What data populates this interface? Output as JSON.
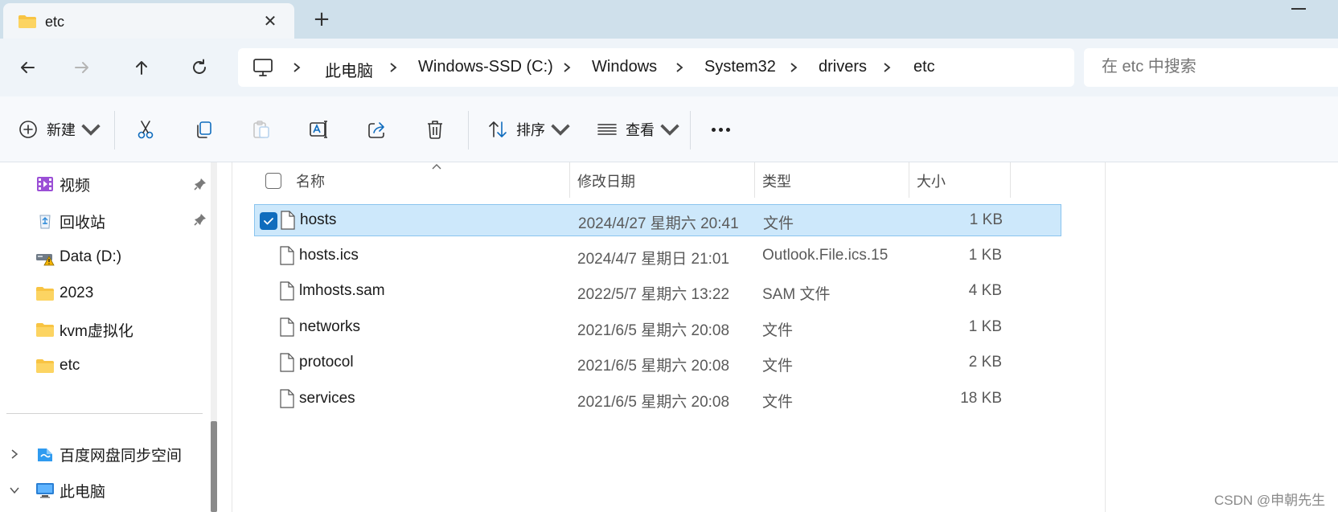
{
  "tab": {
    "title": "etc",
    "close_icon": "close-icon",
    "new_tab_icon": "plus-icon"
  },
  "nav": {
    "back": "back-arrow-icon",
    "forward": "forward-arrow-icon",
    "up": "up-arrow-icon",
    "refresh": "refresh-icon"
  },
  "breadcrumb": [
    "此电脑",
    "Windows-SSD (C:)",
    "Windows",
    "System32",
    "drivers",
    "etc"
  ],
  "search": {
    "placeholder": "在 etc 中搜索"
  },
  "toolbar": {
    "new_label": "新建",
    "sort_label": "排序",
    "view_label": "查看"
  },
  "sidebar": {
    "items": [
      {
        "label": "视频",
        "icon": "video-folder-icon",
        "pinned": true
      },
      {
        "label": "回收站",
        "icon": "recycle-bin-icon",
        "pinned": true
      },
      {
        "label": "Data (D:)",
        "icon": "drive-warning-icon",
        "pinned": false
      },
      {
        "label": "2023",
        "icon": "folder-icon",
        "pinned": false
      },
      {
        "label": "kvm虚拟化",
        "icon": "folder-icon",
        "pinned": false
      },
      {
        "label": "etc",
        "icon": "folder-icon",
        "pinned": false
      }
    ],
    "tree": [
      {
        "label": "百度网盘同步空间",
        "icon": "baidu-netdisk-icon",
        "expanded": false
      },
      {
        "label": "此电脑",
        "icon": "this-pc-icon",
        "expanded": true
      }
    ]
  },
  "columns": {
    "name": "名称",
    "modified": "修改日期",
    "type": "类型",
    "size": "大小"
  },
  "files": [
    {
      "name": "hosts",
      "modified": "2024/4/27 星期六 20:41",
      "type": "文件",
      "size": "1 KB",
      "selected": true
    },
    {
      "name": "hosts.ics",
      "modified": "2024/4/7 星期日 21:01",
      "type": "Outlook.File.ics.15",
      "size": "1 KB",
      "selected": false
    },
    {
      "name": "lmhosts.sam",
      "modified": "2022/5/7 星期六 13:22",
      "type": "SAM 文件",
      "size": "4 KB",
      "selected": false
    },
    {
      "name": "networks",
      "modified": "2021/6/5 星期六 20:08",
      "type": "文件",
      "size": "1 KB",
      "selected": false
    },
    {
      "name": "protocol",
      "modified": "2021/6/5 星期六 20:08",
      "type": "文件",
      "size": "2 KB",
      "selected": false
    },
    {
      "name": "services",
      "modified": "2021/6/5 星期六 20:08",
      "type": "文件",
      "size": "18 KB",
      "selected": false
    }
  ],
  "watermark": "CSDN @申朝先生",
  "colors": {
    "accent": "#0f6cbd",
    "selection": "#cde8fb",
    "folder": "#f8c443"
  }
}
